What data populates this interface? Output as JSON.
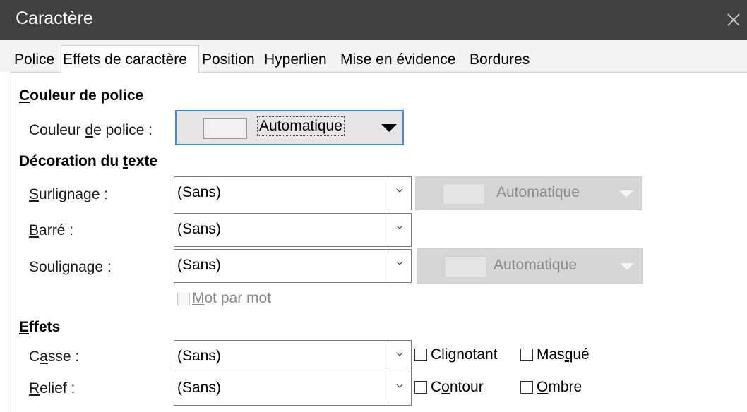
{
  "window": {
    "title": "Caractère"
  },
  "tabs": [
    {
      "label": "Police"
    },
    {
      "label": "Effets de caractère"
    },
    {
      "label": "Position"
    },
    {
      "label": "Hyperlien"
    },
    {
      "label": "Mise en évidence"
    },
    {
      "label": "Bordures"
    }
  ],
  "active_tab": "Effets de caractère",
  "font_color_section": {
    "title_u": "C",
    "title_rest": "ouleur de police",
    "label_pre": "Couleur ",
    "label_u": "d",
    "label_post": "e police :",
    "value": "Automatique"
  },
  "decoration_section": {
    "title_pre": "Décoration du ",
    "title_u": "t",
    "title_post": "exte",
    "overline": {
      "label_u": "S",
      "label_post": "urlignage :",
      "value": "(Sans)",
      "color_value": "Automatique"
    },
    "strikethrough": {
      "label_u": "B",
      "label_post": "arré :",
      "value": "(Sans)"
    },
    "underline": {
      "label_pre": "Souli",
      "label_u": "g",
      "label_post": "nage :",
      "value": "(Sans)",
      "color_value": "Automatique"
    },
    "word_by_word": {
      "label_u": "M",
      "label_post": "ot par mot",
      "checked": false,
      "disabled": true
    }
  },
  "effects_section": {
    "title_u": "E",
    "title_rest": "ffets",
    "case": {
      "label_pre": "C",
      "label_u": "a",
      "label_post": "sse :",
      "value": "(Sans)"
    },
    "relief": {
      "label_u": "R",
      "label_post": "elief :",
      "value": "(Sans)"
    },
    "blinking": {
      "label_pre": "Cli",
      "label_u": "g",
      "label_post": "notant",
      "checked": false
    },
    "hidden": {
      "label_pre": "Mas",
      "label_u": "q",
      "label_post": "ué",
      "checked": false
    },
    "outline": {
      "label_pre": "C",
      "label_u": "o",
      "label_post": "ntour",
      "checked": false
    },
    "shadow": {
      "label_pre": "",
      "label_u": "O",
      "label_post": "mbre",
      "checked": false
    }
  },
  "colors": {
    "titlebar": "#404040",
    "focus": "#3f8fcf",
    "disabled_text": "#8a8a8a"
  }
}
